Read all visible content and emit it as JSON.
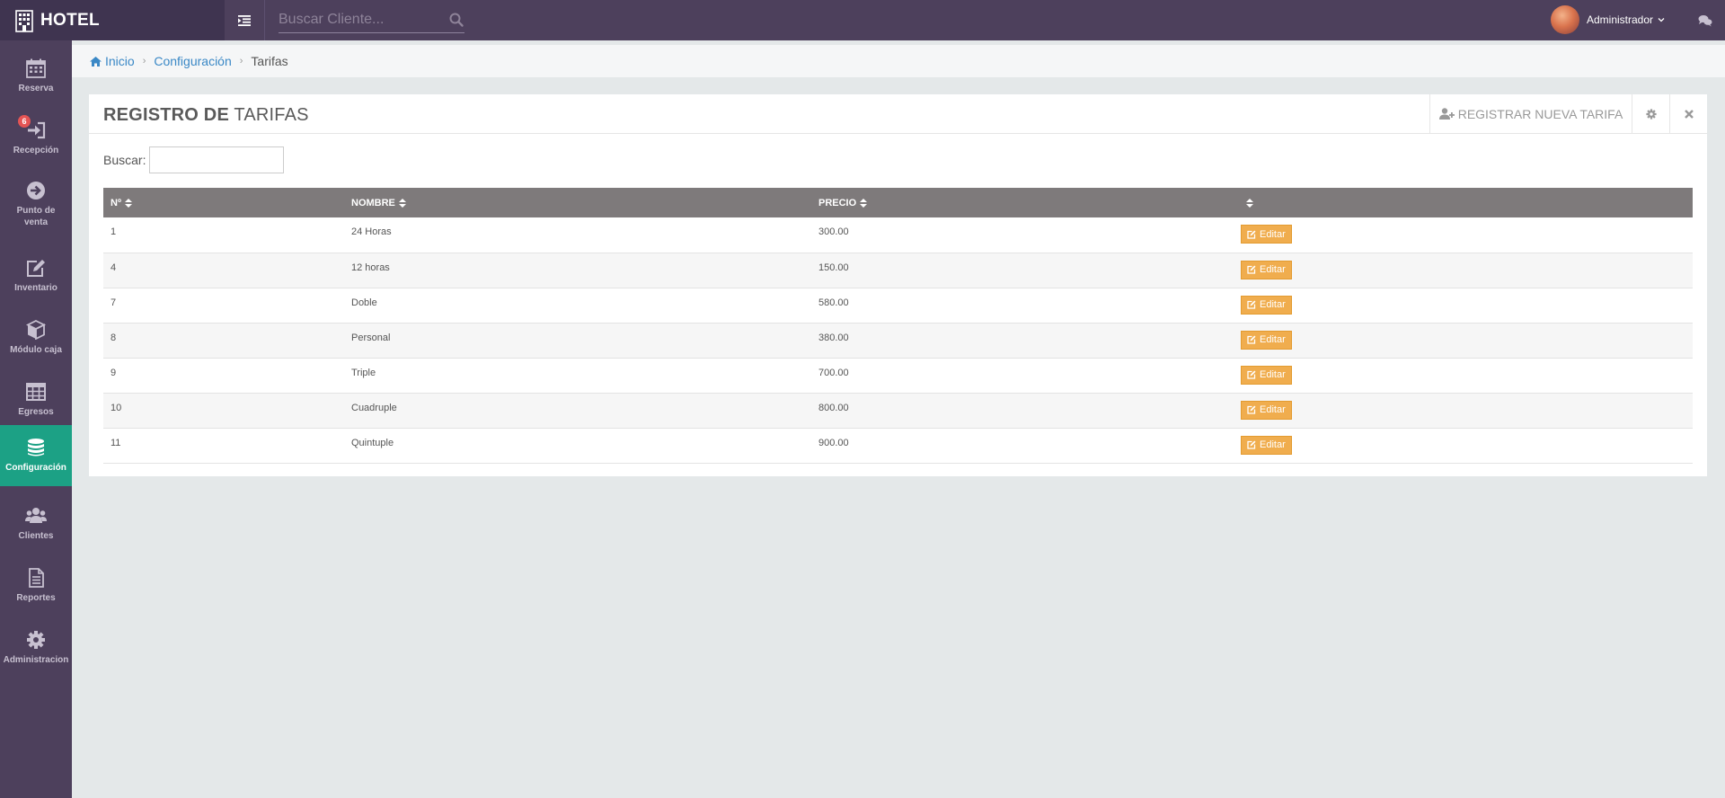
{
  "brand": {
    "title": "HOTEL"
  },
  "header": {
    "search_placeholder": "Buscar Cliente...",
    "user_name": "Administrador"
  },
  "sidebar": {
    "items": [
      {
        "label": "Reserva",
        "icon": "calendar-icon"
      },
      {
        "label": "Recepción",
        "icon": "sign-in-icon",
        "badge": "6"
      },
      {
        "label": "Punto de venta",
        "icon": "arrow-circle-right-icon"
      },
      {
        "label": "Inventario",
        "icon": "edit-icon"
      },
      {
        "label": "Módulo caja",
        "icon": "cube-icon"
      },
      {
        "label": "Egresos",
        "icon": "table-icon"
      },
      {
        "label": "Configuración",
        "icon": "database-icon",
        "active": true
      },
      {
        "label": "Clientes",
        "icon": "users-icon"
      },
      {
        "label": "Reportes",
        "icon": "file-text-icon"
      },
      {
        "label": "Administracion",
        "icon": "gear-icon"
      }
    ]
  },
  "breadcrumb": {
    "home": "Inicio",
    "section": "Configuración",
    "current": "Tarifas"
  },
  "panel": {
    "title_bold": "REGISTRO DE",
    "title_rest": " TARIFAS",
    "register_button": "REGISTRAR NUEVA TARIFA",
    "search_label": "Buscar:"
  },
  "table": {
    "columns": [
      "Nº",
      "NOMBRE",
      "PRECIO",
      ""
    ],
    "edit_label": "Editar",
    "rows": [
      {
        "id": "1",
        "name": "24 Horas",
        "price": "300.00"
      },
      {
        "id": "4",
        "name": "12 horas",
        "price": "150.00"
      },
      {
        "id": "7",
        "name": "Doble",
        "price": "580.00"
      },
      {
        "id": "8",
        "name": "Personal",
        "price": "380.00"
      },
      {
        "id": "9",
        "name": "Triple",
        "price": "700.00"
      },
      {
        "id": "10",
        "name": "Cuadruple",
        "price": "800.00"
      },
      {
        "id": "11",
        "name": "Quintuple",
        "price": "900.00"
      }
    ]
  },
  "colors": {
    "topbar": "#4d405c",
    "sidebar": "#4d405c",
    "active": "#1ca185",
    "edit_button": "#f0ad4e",
    "table_header": "#7e7a7b",
    "link": "#3a88c6"
  }
}
